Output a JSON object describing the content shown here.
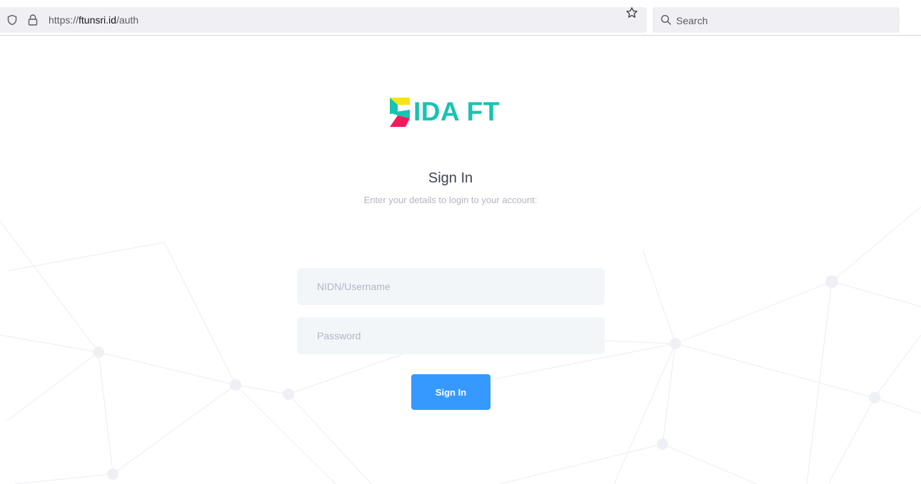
{
  "browser": {
    "url_scheme": "https://",
    "url_host": "ftunsri.id",
    "url_path": "/auth",
    "search_label": "Search"
  },
  "brand": {
    "logo_text": "IDA FT",
    "accent_color": "#17c3b2",
    "logo_colors": [
      "#f5e50c",
      "#17c3b2",
      "#f21c5c"
    ]
  },
  "login": {
    "title": "Sign In",
    "subtitle": "Enter your details to login to your account:",
    "username_placeholder": "NIDN/Username",
    "password_placeholder": "Password",
    "submit_label": "Sign In",
    "button_color": "#3699ff"
  },
  "icons": {
    "shield": "shield-icon",
    "lock": "lock-icon",
    "star": "star-icon",
    "search": "search-icon"
  }
}
